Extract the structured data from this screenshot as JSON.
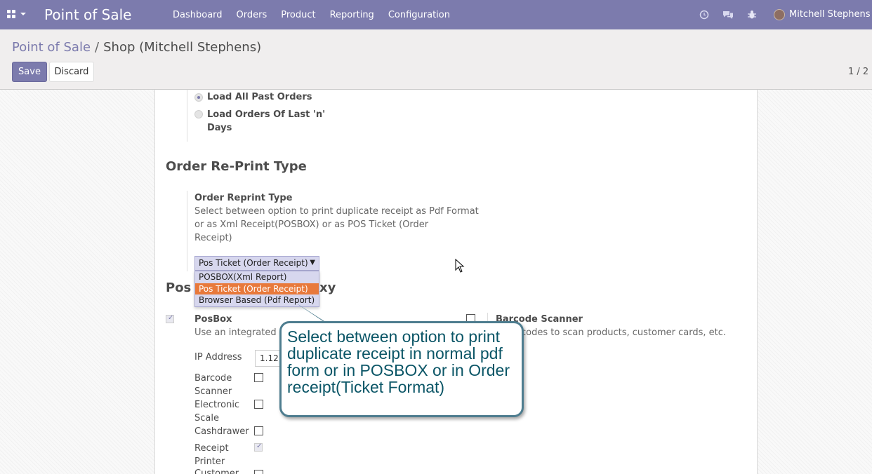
{
  "navbar": {
    "app_title": "Point of Sale",
    "menu": [
      "Dashboard",
      "Orders",
      "Product",
      "Reporting",
      "Configuration"
    ],
    "icons": [
      "clock-icon",
      "chat-icon",
      "bug-icon"
    ],
    "user": "Mitchell Stephens (te",
    "color": "#7c7bad"
  },
  "breadcrumb": {
    "parent": "Point of Sale",
    "separator": "/",
    "current": "Shop (Mitchell Stephens)"
  },
  "buttons": {
    "save": "Save",
    "discard": "Discard"
  },
  "pager": "1 / 2",
  "load_orders": {
    "options": [
      {
        "label": "Load All Past Orders",
        "checked": true
      },
      {
        "label_line1": "Load Orders Of Last 'n'",
        "label_line2": "Days",
        "checked": false
      }
    ]
  },
  "reprint": {
    "section_title": "Order Re-Print Type",
    "field_label": "Order Reprint Type",
    "help_lines": [
      "Select between option to print duplicate receipt as Pdf Format",
      "or as Xml Receipt(POSBOX) or as POS Ticket (Order",
      "Receipt)"
    ],
    "selected": "Pos Ticket (Order Receipt)",
    "options": [
      "POSBOX(Xml Report)",
      "Pos Ticket (Order Receipt)",
      "Browser Based (Pdf Report)"
    ]
  },
  "posbox": {
    "section_title_visible_start": "Pos",
    "section_title_visible_end": "xy",
    "label": "PosBox",
    "help_visible": "Use an integrated ha",
    "ip_label": "IP Address",
    "ip_value": "1.12.",
    "devices": [
      {
        "line1": "Barcode",
        "line2": "Scanner",
        "checked": false
      },
      {
        "line1": "Electronic",
        "line2": "Scale",
        "checked": false
      },
      {
        "line1": "Cashdrawer",
        "line2": "",
        "checked": false
      },
      {
        "line1": "Receipt",
        "line2": "Printer",
        "checked": true
      },
      {
        "line1": "Customer",
        "line2": "",
        "checked": false
      }
    ]
  },
  "barcode": {
    "label": "Barcode Scanner",
    "help_visible": "codes to scan products, customer cards, etc."
  },
  "callout": {
    "lines": [
      "Select between option to print",
      "duplicate receipt in normal pdf",
      "form or in POSBOX or in Order",
      "receipt(Ticket Format)"
    ],
    "border_color": "#4e7d8f",
    "text_color": "#0a5566"
  }
}
